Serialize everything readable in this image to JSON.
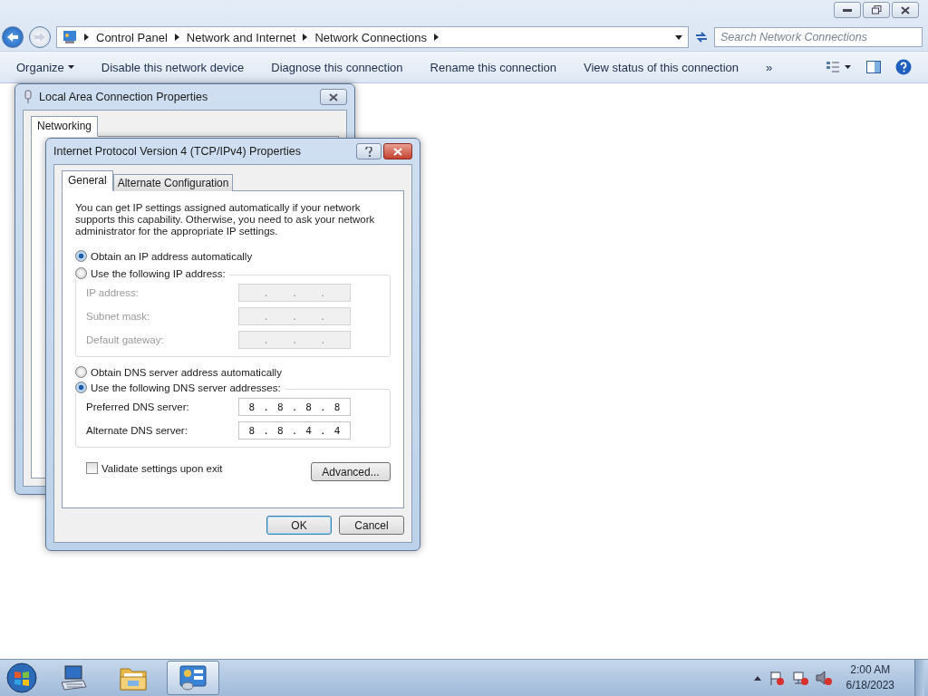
{
  "address_bar": {
    "breadcrumbs": [
      "Control Panel",
      "Network and Internet",
      "Network Connections"
    ]
  },
  "search": {
    "placeholder": "Search Network Connections"
  },
  "toolbar": {
    "items": [
      {
        "label": "Organize",
        "kind": "menu"
      },
      {
        "label": "Disable this network device",
        "kind": "command"
      },
      {
        "label": "Diagnose this connection",
        "kind": "command"
      },
      {
        "label": "Rename this connection",
        "kind": "command"
      },
      {
        "label": "View status of this connection",
        "kind": "command"
      },
      {
        "label": "»",
        "kind": "command"
      }
    ]
  },
  "back_dialog": {
    "title": "Local Area Connection Properties",
    "tabs": [
      {
        "label": "Networking",
        "selected": true
      }
    ]
  },
  "dialog": {
    "title": "Internet Protocol Version 4 (TCP/IPv4) Properties",
    "tabs": [
      {
        "label": "General",
        "selected": true
      },
      {
        "label": "Alternate Configuration",
        "selected": false
      }
    ],
    "intro": "You can get IP settings assigned automatically if your network supports this capability. Otherwise, you need to ask your network administrator for the appropriate IP settings.",
    "separator": ".",
    "ip_options": [
      {
        "label": "Obtain an IP address automatically",
        "selected": true
      },
      {
        "label": "Use the following IP address:",
        "selected": false
      }
    ],
    "ip_fields": [
      {
        "label": "IP address:",
        "disabled": true
      },
      {
        "label": "Subnet mask:",
        "disabled": true
      },
      {
        "label": "Default gateway:",
        "disabled": true
      }
    ],
    "dns_options": [
      {
        "label": "Obtain DNS server address automatically",
        "selected": false
      },
      {
        "label": "Use the following DNS server addresses:",
        "selected": true
      }
    ],
    "dns_fields": [
      {
        "label": "Preferred DNS server:",
        "octets": [
          "8",
          "8",
          "8",
          "8"
        ],
        "disabled": false
      },
      {
        "label": "Alternate DNS server:",
        "octets": [
          "8",
          "8",
          "4",
          "4"
        ],
        "disabled": false
      }
    ],
    "validate": {
      "label": "Validate settings upon exit",
      "checked": false
    },
    "advanced_button": "Advanced...",
    "footer_buttons": [
      {
        "label": "OK",
        "default": true
      },
      {
        "label": "Cancel",
        "default": false
      }
    ]
  },
  "taskbar": {
    "apps": [
      {
        "kind": "computer",
        "active": false
      },
      {
        "kind": "folder",
        "active": false
      },
      {
        "kind": "control-panel",
        "active": true
      }
    ],
    "clock": {
      "time": "2:00 AM",
      "date": "6/18/2023"
    }
  }
}
